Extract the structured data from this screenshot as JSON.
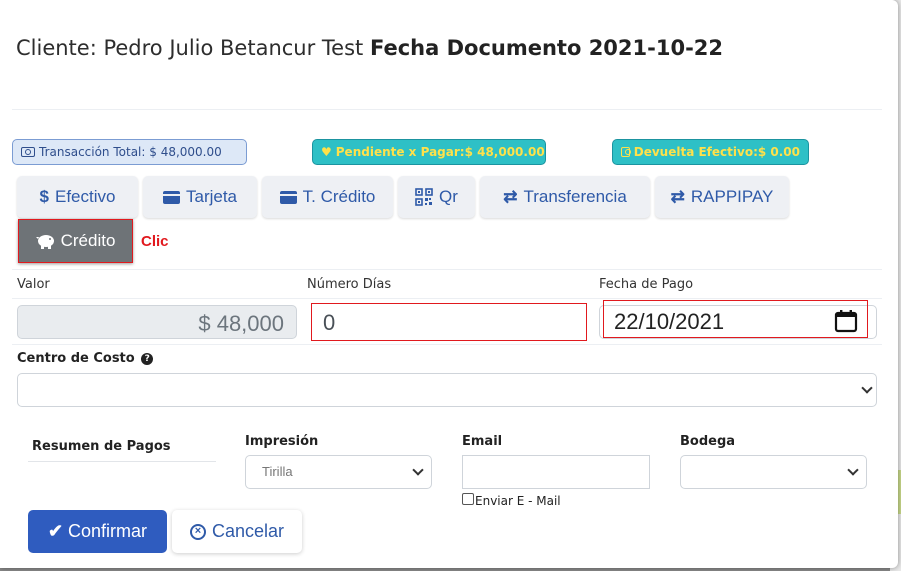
{
  "header": {
    "client_prefix": "Cliente: Pedro Julio Betancur Test",
    "date_label": "Fecha Documento 2021-10-22"
  },
  "badges": {
    "total": "Transacción Total: $ 48,000.00",
    "pending": "Pendiente x Pagar:$ 48,000.00",
    "change": "Devuelta Efectivo:$ 0.00"
  },
  "payment_methods": [
    {
      "label": "Efectivo",
      "icon": "dollar-icon"
    },
    {
      "label": "Tarjeta",
      "icon": "credit-card-icon"
    },
    {
      "label": "T. Crédito",
      "icon": "credit-card-icon"
    },
    {
      "label": "Qr",
      "icon": "qrcode-icon"
    },
    {
      "label": "Transferencia",
      "icon": "exchange-icon"
    },
    {
      "label": "RAPPIPAY",
      "icon": "exchange-icon"
    },
    {
      "label": "Crédito",
      "icon": "piggy-bank-icon",
      "selected": true
    }
  ],
  "annotation": "Clic",
  "form": {
    "valor_label": "Valor",
    "valor_value": "$ 48,000",
    "dias_label": "Número Días",
    "dias_value": "0",
    "fecha_label": "Fecha de Pago",
    "fecha_value": "22/10/2021",
    "centro_label": "Centro de Costo",
    "centro_value": ""
  },
  "footer": {
    "resumen_label": "Resumen de Pagos",
    "impresion_label": "Impresión",
    "impresion_value": "Tirilla",
    "email_label": "Email",
    "email_value": "",
    "enviar_label": "Enviar E - Mail",
    "bodega_label": "Bodega",
    "bodega_value": ""
  },
  "actions": {
    "confirm": "Confirmar",
    "cancel": "Cancelar"
  },
  "colors": {
    "primary": "#2f5cbf",
    "teal_badge": "#2ec0c6",
    "badge_text_yellow": "#ffe14a",
    "highlight_red": "#e1191e"
  }
}
